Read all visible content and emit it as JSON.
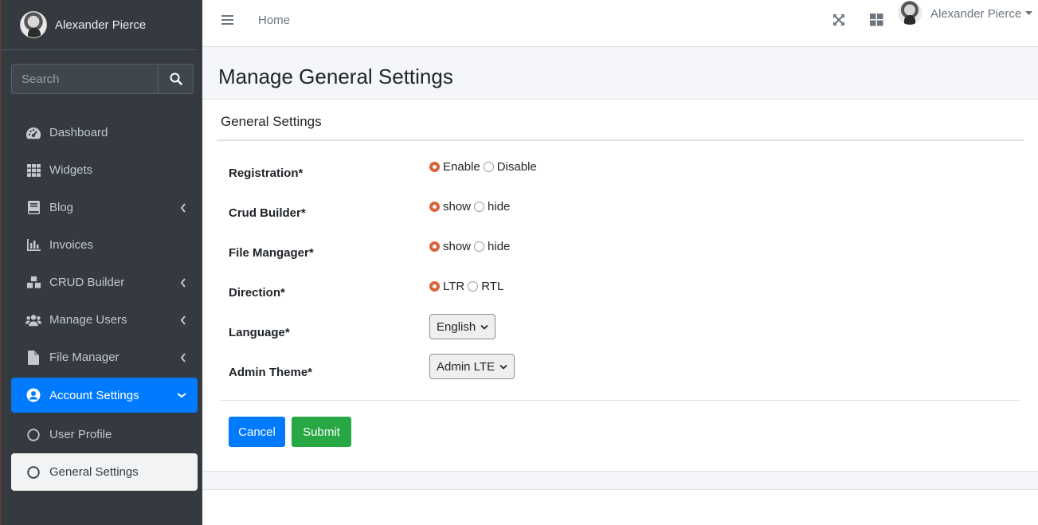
{
  "sidebar": {
    "user_name": "Alexander Pierce",
    "search_placeholder": "Search",
    "items": [
      {
        "label": "Dashboard",
        "icon": "tachometer-icon"
      },
      {
        "label": "Widgets",
        "icon": "th-icon"
      },
      {
        "label": "Blog",
        "icon": "book-icon"
      },
      {
        "label": "Invoices",
        "icon": "chart-bar-icon"
      },
      {
        "label": "CRUD Builder",
        "icon": "cubes-icon"
      },
      {
        "label": "Manage Users",
        "icon": "users-icon"
      },
      {
        "label": "File Manager",
        "icon": "file-icon"
      },
      {
        "label": "Account Settings",
        "icon": "user-circle-icon"
      },
      {
        "label": "User Profile",
        "icon": "circle-icon"
      },
      {
        "label": "General Settings",
        "icon": "circle-icon"
      }
    ]
  },
  "topbar": {
    "home_label": "Home",
    "user_name": "Alexander Pierce"
  },
  "page": {
    "title": "Manage General Settings",
    "card_title": "General Settings"
  },
  "form": {
    "registration": {
      "label": "Registration*",
      "options": [
        "Enable",
        "Disable"
      ],
      "selected": "Enable"
    },
    "crud_builder": {
      "label": "Crud Builder*",
      "options": [
        "show",
        "hide"
      ],
      "selected": "show"
    },
    "file_manager": {
      "label": "File Mangager*",
      "options": [
        "show",
        "hide"
      ],
      "selected": "show"
    },
    "direction": {
      "label": "Direction*",
      "options": [
        "LTR",
        "RTL"
      ],
      "selected": "LTR"
    },
    "language": {
      "label": "Language*",
      "value": "English"
    },
    "admin_theme": {
      "label": "Admin Theme*",
      "value": "Admin LTE"
    },
    "cancel_label": "Cancel",
    "submit_label": "Submit"
  },
  "colors": {
    "sidebar_bg": "#343a40",
    "primary": "#007bff",
    "success": "#28a745",
    "radio_checked": "#d9643a"
  }
}
